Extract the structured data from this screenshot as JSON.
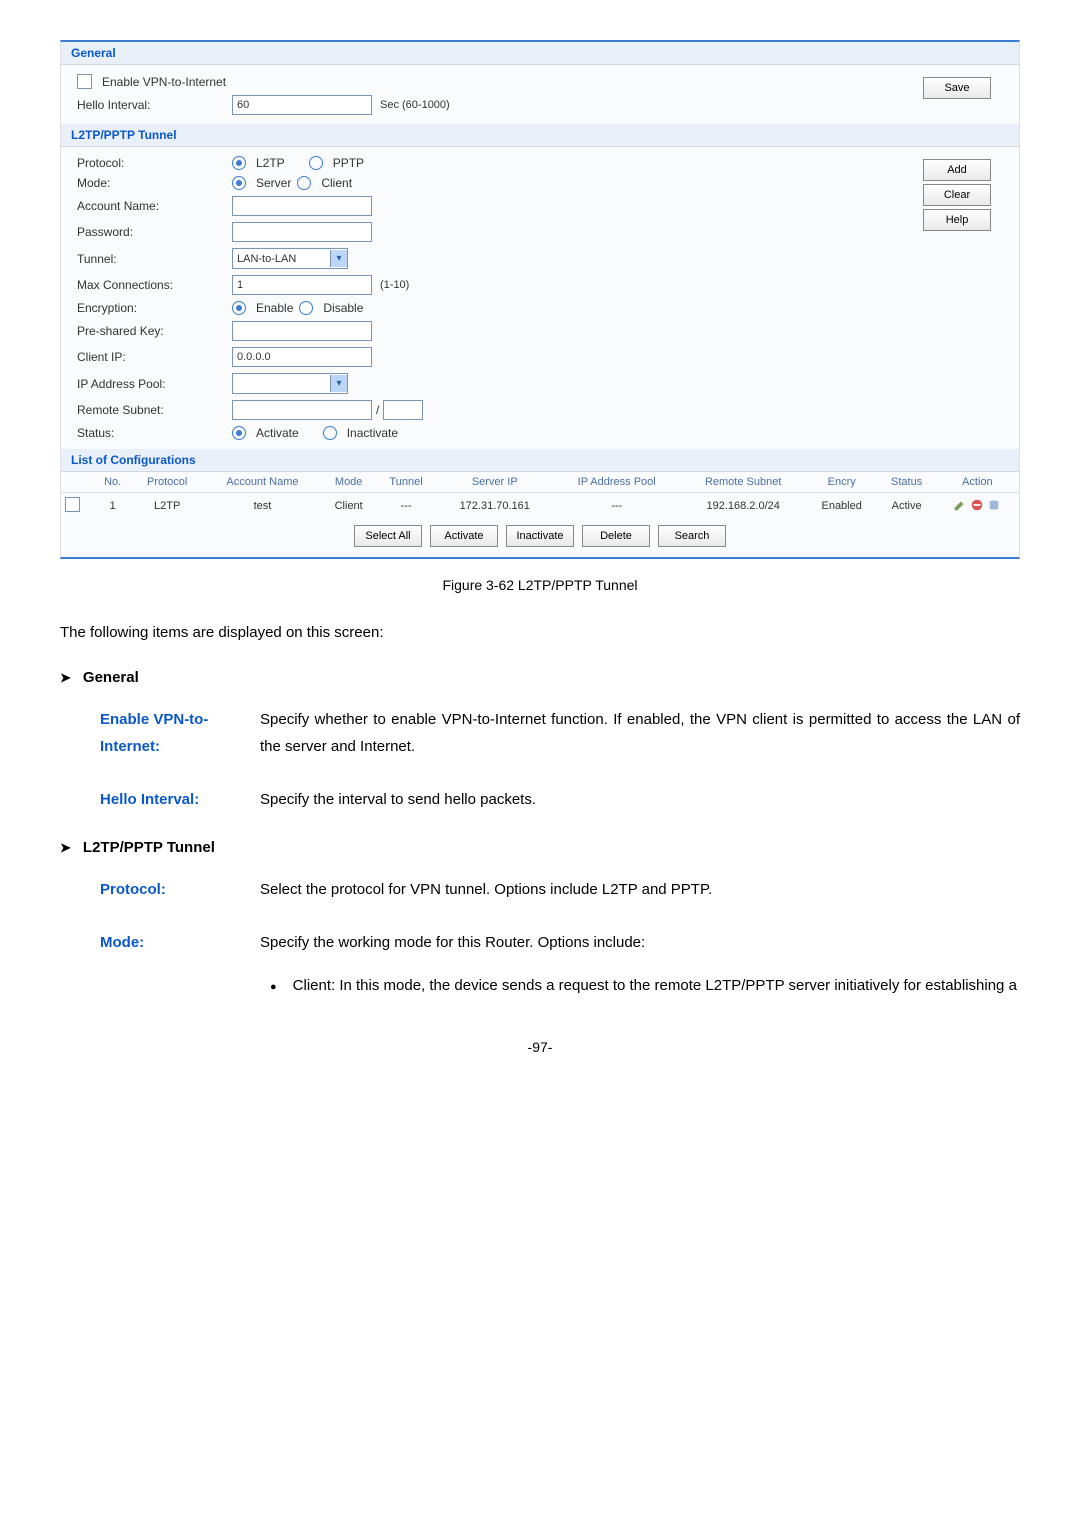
{
  "general": {
    "title": "General",
    "enable_vpn_label": "Enable VPN-to-Internet",
    "hello_interval_label": "Hello Interval:",
    "hello_interval_value": "60",
    "hello_interval_hint": "Sec (60-1000)",
    "save_btn": "Save"
  },
  "tunnel": {
    "title": "L2TP/PPTP Tunnel",
    "protocol_label": "Protocol:",
    "protocol_opt1": "L2TP",
    "protocol_opt2": "PPTP",
    "mode_label": "Mode:",
    "mode_opt1": "Server",
    "mode_opt2": "Client",
    "account_label": "Account Name:",
    "password_label": "Password:",
    "tunnel_label": "Tunnel:",
    "tunnel_value": "LAN-to-LAN",
    "maxconn_label": "Max Connections:",
    "maxconn_value": "1",
    "maxconn_hint": "(1-10)",
    "encryption_label": "Encryption:",
    "encryption_opt1": "Enable",
    "encryption_opt2": "Disable",
    "psk_label": "Pre-shared Key:",
    "clientip_label": "Client IP:",
    "clientip_value": "0.0.0.0",
    "ippool_label": "IP Address Pool:",
    "remotesubnet_label": "Remote Subnet:",
    "remotesubnet_sep": "/",
    "status_label": "Status:",
    "status_opt1": "Activate",
    "status_opt2": "Inactivate",
    "add_btn": "Add",
    "clear_btn": "Clear",
    "help_btn": "Help"
  },
  "list": {
    "title": "List of Configurations",
    "headers": [
      "",
      "No.",
      "Protocol",
      "Account Name",
      "Mode",
      "Tunnel",
      "Server IP",
      "IP Address Pool",
      "Remote Subnet",
      "Encry",
      "Status",
      "Action"
    ],
    "rows": [
      {
        "no": "1",
        "protocol": "L2TP",
        "account": "test",
        "mode": "Client",
        "tunnel": "---",
        "serverip": "172.31.70.161",
        "pool": "---",
        "remote": "192.168.2.0/24",
        "encry": "Enabled",
        "status": "Active"
      }
    ],
    "btns": [
      "Select All",
      "Activate",
      "Inactivate",
      "Delete",
      "Search"
    ]
  },
  "caption": "Figure 3-62 L2TP/PPTP Tunnel",
  "intro": "The following items are displayed on this screen:",
  "sec1": {
    "title": "General",
    "term1": "Enable VPN-to-Internet:",
    "desc1": "Specify whether to enable VPN-to-Internet function. If enabled, the VPN client is permitted to access the LAN of the server and Internet.",
    "term2": "Hello Interval:",
    "desc2": "Specify the interval to send hello packets."
  },
  "sec2": {
    "title": "L2TP/PPTP Tunnel",
    "term1": "Protocol:",
    "desc1": "Select the protocol for VPN tunnel. Options include L2TP and PPTP.",
    "term2": "Mode:",
    "desc2": "Specify the working mode for this Router. Options include:",
    "bullet1": "Client: In this mode, the device sends a request to the remote L2TP/PPTP server initiatively for establishing a"
  },
  "pagenum": "-97-"
}
